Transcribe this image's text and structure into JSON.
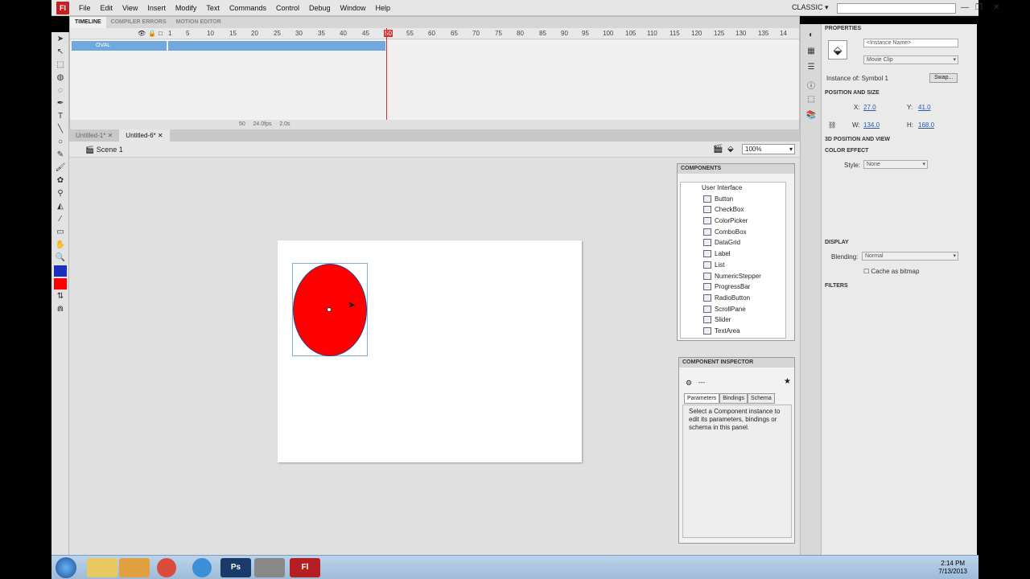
{
  "app": {
    "logo": "Fl",
    "workspace": "CLASSIC",
    "search_placeholder": "",
    "menus": [
      "File",
      "Edit",
      "View",
      "Insert",
      "Modify",
      "Text",
      "Commands",
      "Control",
      "Debug",
      "Window",
      "Help"
    ]
  },
  "timeline": {
    "tabs": [
      "TIMELINE",
      "COMPILER ERRORS",
      "MOTION EDITOR"
    ],
    "layer_name": "OVAL",
    "frame_numbers": [
      "1",
      "5",
      "10",
      "15",
      "20",
      "25",
      "30",
      "35",
      "40",
      "45",
      "50",
      "55",
      "60",
      "65",
      "70",
      "75",
      "80",
      "85",
      "90",
      "95",
      "100",
      "105",
      "110",
      "115",
      "120",
      "125",
      "130",
      "135",
      "14"
    ],
    "current_frame": "50",
    "fps": "24.0fps",
    "time": "2.0s",
    "playhead_label": "50"
  },
  "docs": {
    "tabs": [
      "Untitled-1*",
      "Untitled-6*"
    ]
  },
  "scene": {
    "name": "Scene 1",
    "zoom": "100%"
  },
  "components": {
    "title": "COMPONENTS",
    "folder": "User Interface",
    "items": [
      "Button",
      "CheckBox",
      "ColorPicker",
      "ComboBox",
      "DataGrid",
      "Label",
      "List",
      "NumericStepper",
      "ProgressBar",
      "RadioButton",
      "ScrollPane",
      "Slider",
      "TextArea"
    ]
  },
  "inspector": {
    "title": "COMPONENT INSPECTOR",
    "dash": "---",
    "tabs": [
      "Parameters",
      "Bindings",
      "Schema"
    ],
    "message": "Select a Component instance to edit its parameters, bindings or schema in this panel."
  },
  "properties": {
    "title": "PROPERTIES",
    "instance_name": "<Instance Name>",
    "type": "Movie Clip",
    "instance_of": "Instance of: Symbol 1",
    "swap": "Swap...",
    "pos_section": "POSITION AND SIZE",
    "x_label": "X:",
    "x": "27.0",
    "y_label": "Y:",
    "y": "41.0",
    "w_label": "W:",
    "w": "134.0",
    "h_label": "H:",
    "h": "168.0",
    "pos3d": "3D POSITION AND VIEW",
    "color_effect": "COLOR EFFECT",
    "style_label": "Style:",
    "style": "None",
    "display": "DISPLAY",
    "blending_label": "Blending:",
    "blending": "Normal",
    "cache": "Cache as bitmap",
    "filters": "FILTERS"
  },
  "taskbar": {
    "time": "2:14 PM",
    "date": "7/13/2013",
    "apps": [
      "Ps",
      "Fl"
    ]
  },
  "colors": {
    "oval": "#ff0000",
    "layer": "#6fa8dc",
    "playhead": "#d23232"
  }
}
